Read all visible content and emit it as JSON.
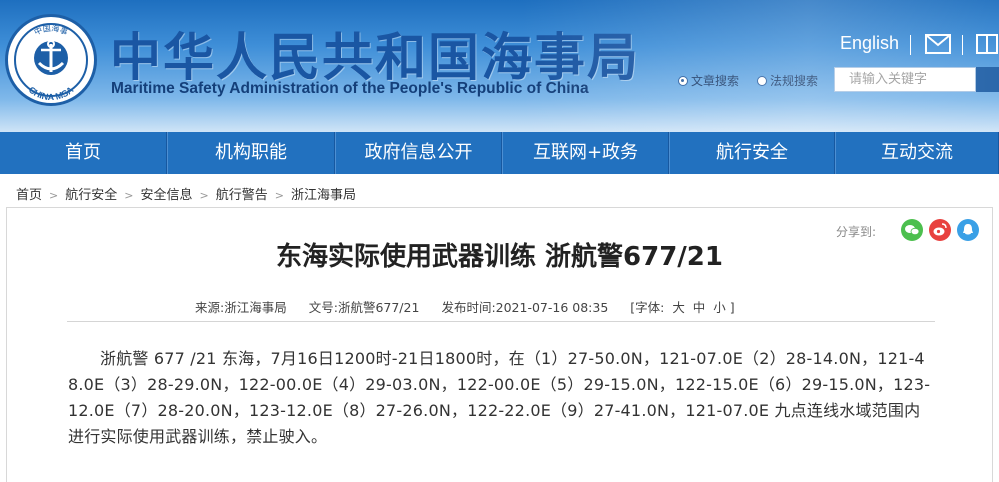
{
  "header": {
    "title": "中华人民共和国海事局",
    "subtitle": "Maritime Safety Administration of the People's Republic of China",
    "logo_top_text": "中国海事",
    "logo_bottom_text": "CHINA MSA",
    "english_link": "English",
    "search_options": [
      "文章搜索",
      "法规搜索"
    ],
    "search_placeholder": "请输入关键字"
  },
  "nav": {
    "items": [
      "首页",
      "机构职能",
      "政府信息公开",
      "互联网+政务",
      "航行安全",
      "互动交流"
    ]
  },
  "breadcrumb": [
    "首页",
    "航行安全",
    "安全信息",
    "航行警告",
    "浙江海事局"
  ],
  "share": {
    "label": "分享到:",
    "icons": [
      "wechat-icon",
      "weibo-icon",
      "qq-icon"
    ]
  },
  "article": {
    "title": "东海实际使用武器训练 浙航警677/21",
    "source_label": "来源:",
    "source": "浙江海事局",
    "doc_no_label": "文号:",
    "doc_no": "浙航警677/21",
    "date_label": "发布时间:",
    "date": "2021-07-16 08:35",
    "font_size_controls": "[字体:  大  中  小 ]",
    "body": "浙航警 677 /21 东海，7月16日1200时-21日1800时，在（1）27-50.0N，121-07.0E（2）28-14.0N，121-48.0E（3）28-29.0N，122-00.0E（4）29-03.0N，122-00.0E（5）29-15.0N，122-15.0E（6）29-15.0N，123-12.0E（7）28-20.0N，123-12.0E（8）27-26.0N，122-22.0E（9）27-41.0N，121-07.0E 九点连线水域范围内进行实际使用武器训练，禁止驶入。"
  },
  "colors": {
    "brand_blue": "#1a56a3",
    "nav_blue": "#2271bf"
  }
}
